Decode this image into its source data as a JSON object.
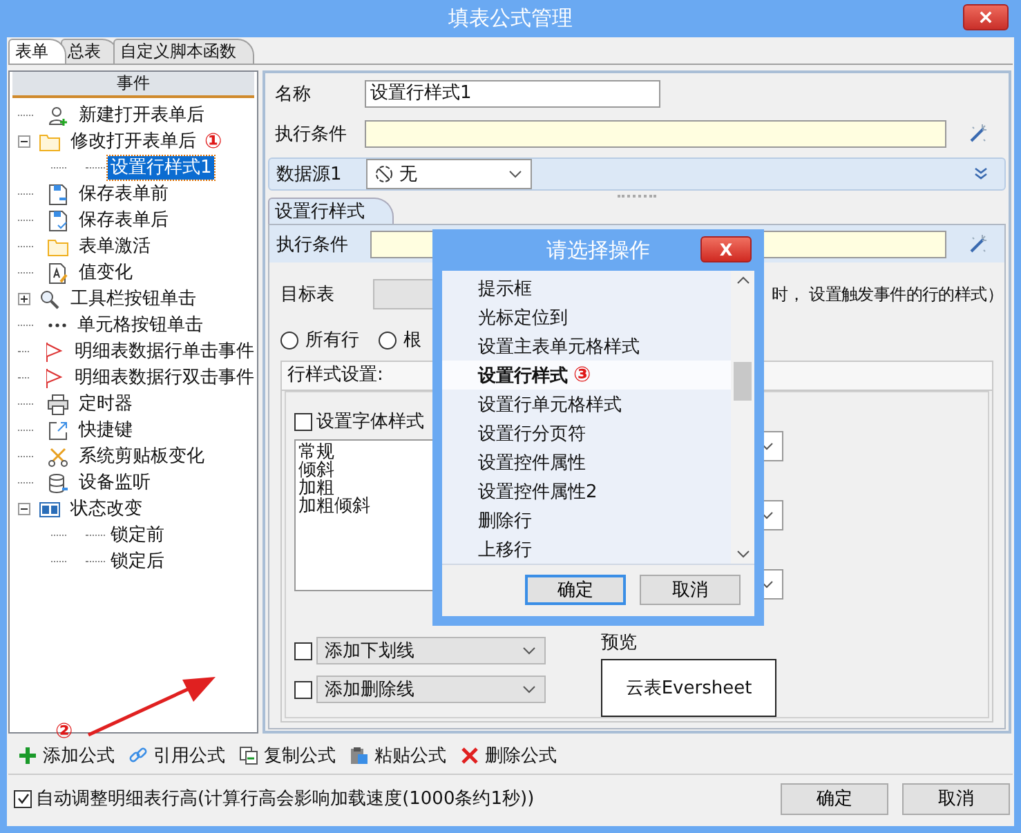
{
  "window": {
    "title": "填表公式管理"
  },
  "tabs": [
    {
      "label": "表单",
      "selected": true
    },
    {
      "label": "总表",
      "selected": false
    },
    {
      "label": "自定义脚本函数",
      "selected": false
    }
  ],
  "event_tree": {
    "header": "事件",
    "items": [
      {
        "label": "新建打开表单后",
        "kind": "user-add",
        "selected": false
      },
      {
        "label": "修改打开表单后",
        "kind": "folder",
        "selected": false,
        "expanded": true,
        "annotation": "①",
        "children": [
          {
            "label": "设置行样式1",
            "kind": "leaf",
            "selected": true
          }
        ]
      },
      {
        "label": "保存表单前",
        "kind": "save-in",
        "selected": false
      },
      {
        "label": "保存表单后",
        "kind": "save-out",
        "selected": false
      },
      {
        "label": "表单激活",
        "kind": "folder",
        "selected": false
      },
      {
        "label": "值变化",
        "kind": "doc-edit",
        "selected": false
      },
      {
        "label": "工具栏按钮单击",
        "kind": "magnifier",
        "selected": false,
        "expanded": false
      },
      {
        "label": "单元格按钮单击",
        "kind": "dots",
        "selected": false
      },
      {
        "label": "明细表数据行单击事件",
        "kind": "flag",
        "selected": false
      },
      {
        "label": "明细表数据行双击事件",
        "kind": "flag",
        "selected": false
      },
      {
        "label": "定时器",
        "kind": "printer",
        "selected": false
      },
      {
        "label": "快捷键",
        "kind": "shortcut",
        "selected": false
      },
      {
        "label": "系统剪贴板变化",
        "kind": "scissors",
        "selected": false
      },
      {
        "label": "设备监听",
        "kind": "database",
        "selected": false
      },
      {
        "label": "状态改变",
        "kind": "xf",
        "selected": false,
        "expanded": true,
        "children": [
          {
            "label": "锁定前",
            "kind": "leaf",
            "selected": false
          },
          {
            "label": "锁定后",
            "kind": "leaf",
            "selected": false
          }
        ]
      }
    ]
  },
  "formula": {
    "name_label": "名称",
    "name_value": "设置行样式1",
    "condition_label": "执行条件",
    "datasource": {
      "label": "数据源1",
      "value": "无"
    }
  },
  "action_tab": {
    "label": "设置行样式",
    "condition_label": "执行条件",
    "target_label": "目标表",
    "target_hint": "时， 设置触发事件的行的样式）",
    "radios": [
      {
        "label": "所有行",
        "selected": false
      },
      {
        "label": "根",
        "selected": false
      }
    ],
    "group_title": "行样式设置:",
    "font_style": {
      "label": "设置字体样式",
      "checked": false,
      "options": [
        "常规",
        "倾斜",
        "加粗",
        "加粗倾斜"
      ]
    },
    "underline": {
      "label": "添加下划线",
      "checked": false
    },
    "strikethrough": {
      "label": "添加删除线",
      "checked": false
    },
    "preview_label": "预览",
    "preview_text": "云表Eversheet"
  },
  "toolbar": [
    {
      "label": "添加公式",
      "kind": "add",
      "annotation": "②"
    },
    {
      "label": "引用公式",
      "kind": "link"
    },
    {
      "label": "复制公式",
      "kind": "copy"
    },
    {
      "label": "粘贴公式",
      "kind": "paste"
    },
    {
      "label": "删除公式",
      "kind": "delete"
    }
  ],
  "auto_height": {
    "label": "自动调整明细表行高(计算行高会影响加载速度(1000条约1秒))",
    "checked": true
  },
  "buttons": [
    "确定",
    "取消"
  ],
  "dialog": {
    "title": "请选择操作",
    "close": "X",
    "items": [
      {
        "label": "提示框",
        "selected": false
      },
      {
        "label": "光标定位到",
        "selected": false
      },
      {
        "label": "设置主表单元格样式",
        "selected": false
      },
      {
        "label": "设置行样式",
        "selected": true,
        "annotation": "③"
      },
      {
        "label": "设置行单元格样式",
        "selected": false
      },
      {
        "label": "设置行分页符",
        "selected": false
      },
      {
        "label": "设置控件属性",
        "selected": false
      },
      {
        "label": "设置控件属性2",
        "selected": false
      },
      {
        "label": "删除行",
        "selected": false
      },
      {
        "label": "上移行",
        "selected": false
      }
    ],
    "buttons": [
      "确定",
      "取消"
    ]
  }
}
